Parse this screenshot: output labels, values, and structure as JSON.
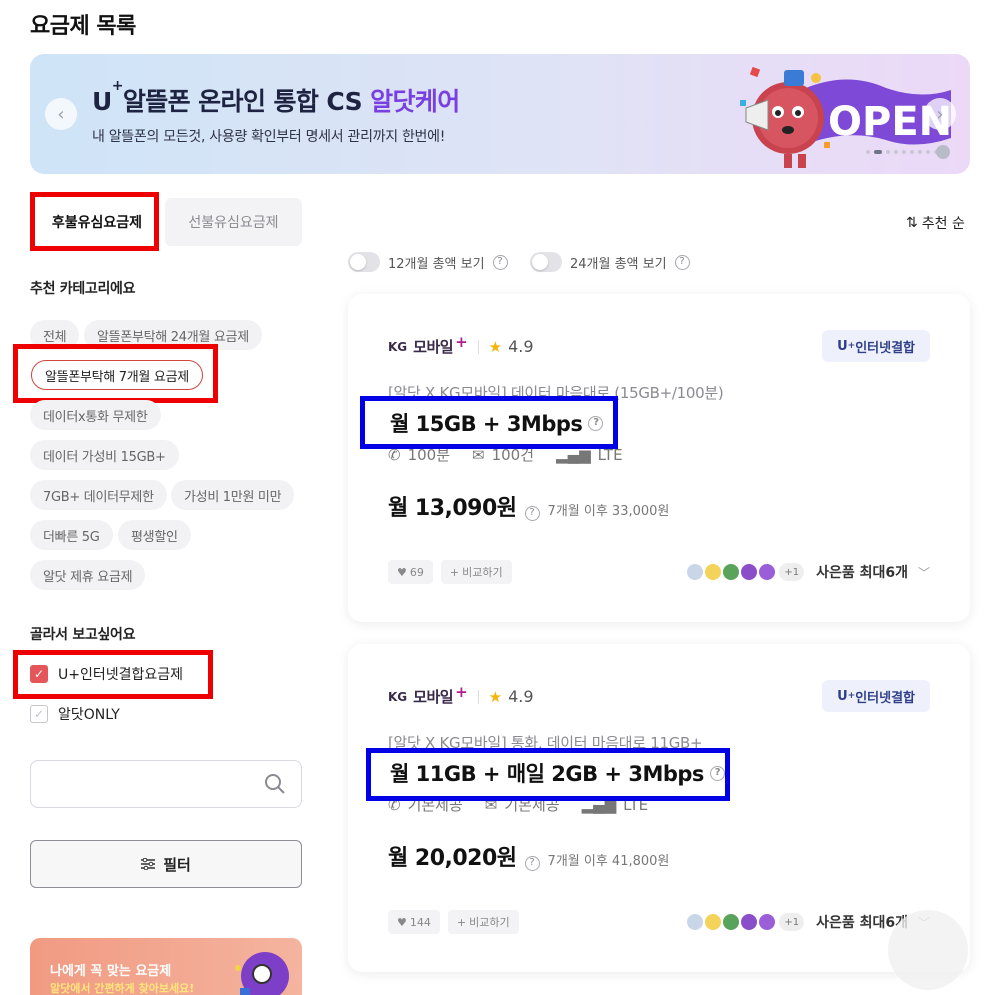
{
  "page": {
    "title": "요금제 목록"
  },
  "banner": {
    "title_prefix": "U",
    "title_sup": "+",
    "title_main": "알뜰폰 온라인 통합 CS ",
    "title_accent": "알닷케어",
    "subtitle": "내 알뜰폰의 모든것, 사용량 확인부터 명세서 관리까지 한번에!",
    "art_text": "OPEN"
  },
  "tabs": {
    "postpaid": "후불유심요금제",
    "prepaid": "선불유심요금제"
  },
  "sort": {
    "label": "추천 순"
  },
  "categories": {
    "label": "추천 카테고리에요",
    "items": [
      "전체",
      "알뜰폰부탁해 24개월 요금제",
      "알뜰폰부탁해 7개월 요금제",
      "데이터x통화 무제한",
      "데이터 가성비 15GB+",
      "7GB+ 데이터무제한",
      "가성비 1만원 미만",
      "더빠른 5G",
      "평생할인",
      "알닷 제휴 요금제"
    ],
    "selected": "알뜰폰부탁해 7개월 요금제"
  },
  "picks": {
    "label": "골라서 보고싶어요",
    "options": [
      {
        "label": "U+인터넷결합요금제",
        "checked": true
      },
      {
        "label": "알닷ONLY",
        "checked": false
      }
    ]
  },
  "search": {
    "value": ""
  },
  "filter": {
    "label": "필터"
  },
  "toggles": {
    "total12": "12개월 총액 보기",
    "total24": "24개월 총액 보기"
  },
  "promo": {
    "title": "나에게 꼭 맞는 요금제",
    "subtitle": "알닷에서 간편하게 찾아보세요!"
  },
  "plans": [
    {
      "brand_kg": "KG",
      "brand_name": "모바일",
      "brand_plus": "+",
      "rating": "4.9",
      "badge": "인터넷결합",
      "badge_prefix": "U",
      "badge_sup": "+",
      "name": "[알닷 X KG모바일] 데이터 마음대로 (15GB+/100분)",
      "data": "월 15GB + 3Mbps",
      "calls": "100분",
      "sms": "100건",
      "network": "LTE",
      "price": "월 13,090원",
      "after": "7개월 이후 33,000원",
      "likes": "69",
      "compare": "비교하기",
      "gift_count": "+1",
      "gifts": "사은품 최대6개"
    },
    {
      "brand_kg": "KG",
      "brand_name": "모바일",
      "brand_plus": "+",
      "rating": "4.9",
      "badge": "인터넷결합",
      "badge_prefix": "U",
      "badge_sup": "+",
      "name": "[알닷 X KG모바일] 통화, 데이터 마음대로 11GB+",
      "data": "월 11GB + 매일 2GB + 3Mbps",
      "calls": "기본제공",
      "sms": "기본제공",
      "network": "LTE",
      "price": "월 20,020원",
      "after": "7개월 이후 41,800원",
      "likes": "144",
      "compare": "비교하기",
      "gift_count": "+1",
      "gifts": "사은품 최대6개"
    }
  ],
  "colors": {
    "accent": "#7a3fe0",
    "check": "#e5565a",
    "annotation_red": "#ee0000",
    "annotation_blue": "#0000e6"
  }
}
